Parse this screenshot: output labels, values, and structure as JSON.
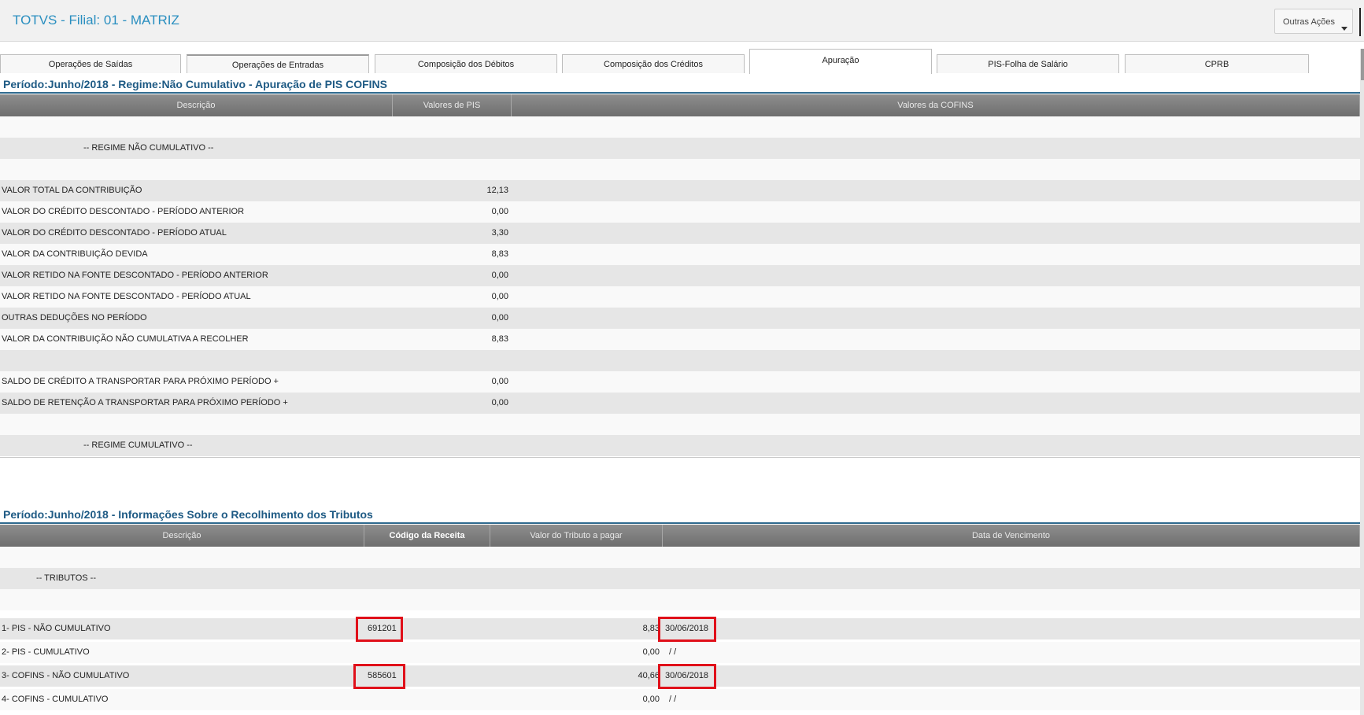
{
  "header": {
    "title": "TOTVS - Filial: 01 - MATRIZ",
    "actions_button": "Outras Ações"
  },
  "tabs": [
    "Operações de Saídas",
    "Operações de Entradas",
    "Composição dos Débitos",
    "Composição dos Créditos",
    "Apuração",
    "PIS-Folha de Salário",
    "CPRB"
  ],
  "active_tab": "Apuração",
  "apuracao": {
    "title": "Período:Junho/2018 - Regime:Não Cumulativo - Apuração de PIS COFINS",
    "columns": [
      "Descrição",
      "Valores de PIS",
      "Valores da COFINS"
    ],
    "rows": [
      {
        "desc": "",
        "pis": "",
        "cofins": ""
      },
      {
        "desc": "-- REGIME NÃO CUMULATIVO --",
        "pis": "",
        "cofins": ""
      },
      {
        "desc": "",
        "pis": "",
        "cofins": ""
      },
      {
        "desc": "VALOR TOTAL DA CONTRIBUIÇÃO",
        "pis": "12,13",
        "cofins": ""
      },
      {
        "desc": "VALOR DO CRÉDITO DESCONTADO - PERÍODO ANTERIOR",
        "pis": "0,00",
        "cofins": ""
      },
      {
        "desc": "VALOR DO CRÉDITO DESCONTADO - PERÍODO ATUAL",
        "pis": "3,30",
        "cofins": ""
      },
      {
        "desc": "VALOR DA CONTRIBUIÇÃO DEVIDA",
        "pis": "8,83",
        "cofins": ""
      },
      {
        "desc": "VALOR RETIDO NA FONTE DESCONTADO - PERÍODO ANTERIOR",
        "pis": "0,00",
        "cofins": ""
      },
      {
        "desc": "VALOR RETIDO NA FONTE DESCONTADO - PERÍODO ATUAL",
        "pis": "0,00",
        "cofins": ""
      },
      {
        "desc": "OUTRAS DEDUÇÕES NO PERÍODO",
        "pis": "0,00",
        "cofins": ""
      },
      {
        "desc": "VALOR DA CONTRIBUIÇÃO NÃO CUMULATIVA A RECOLHER",
        "pis": "8,83",
        "cofins": ""
      },
      {
        "desc": "",
        "pis": "",
        "cofins": ""
      },
      {
        "desc": "SALDO DE CRÉDITO A TRANSPORTAR PARA PRÓXIMO PERÍODO +",
        "pis": "0,00",
        "cofins": ""
      },
      {
        "desc": "SALDO DE RETENÇÃO A TRANSPORTAR PARA PRÓXIMO PERÍODO +",
        "pis": "0,00",
        "cofins": ""
      },
      {
        "desc": "",
        "pis": "",
        "cofins": ""
      },
      {
        "desc": "-- REGIME CUMULATIVO --",
        "pis": "",
        "cofins": ""
      }
    ]
  },
  "recolhimento": {
    "title": "Período:Junho/2018 - Informações Sobre o Recolhimento dos Tributos",
    "columns": [
      "Descrição",
      "Código da Receita",
      "Valor do Tributo a pagar",
      "Data de Vencimento"
    ],
    "rows": [
      {
        "desc": "",
        "codigo": "",
        "valor": "",
        "data": ""
      },
      {
        "desc": "-- TRIBUTOS --",
        "codigo": "",
        "valor": "",
        "data": ""
      },
      {
        "desc": "",
        "codigo": "",
        "valor": "",
        "data": ""
      },
      {
        "desc": "1- PIS - NÃO CUMULATIVO",
        "codigo": "691201",
        "valor": "8,83",
        "data": "30/06/2018"
      },
      {
        "desc": "2- PIS - CUMULATIVO",
        "codigo": "",
        "valor": "0,00",
        "data": "/  /"
      },
      {
        "desc": "3- COFINS - NÃO CUMULATIVO",
        "codigo": "585601",
        "valor": "40,66",
        "data": "30/06/2018"
      },
      {
        "desc": "4- COFINS - CUMULATIVO",
        "codigo": "",
        "valor": "0,00",
        "data": "/  /"
      }
    ]
  }
}
